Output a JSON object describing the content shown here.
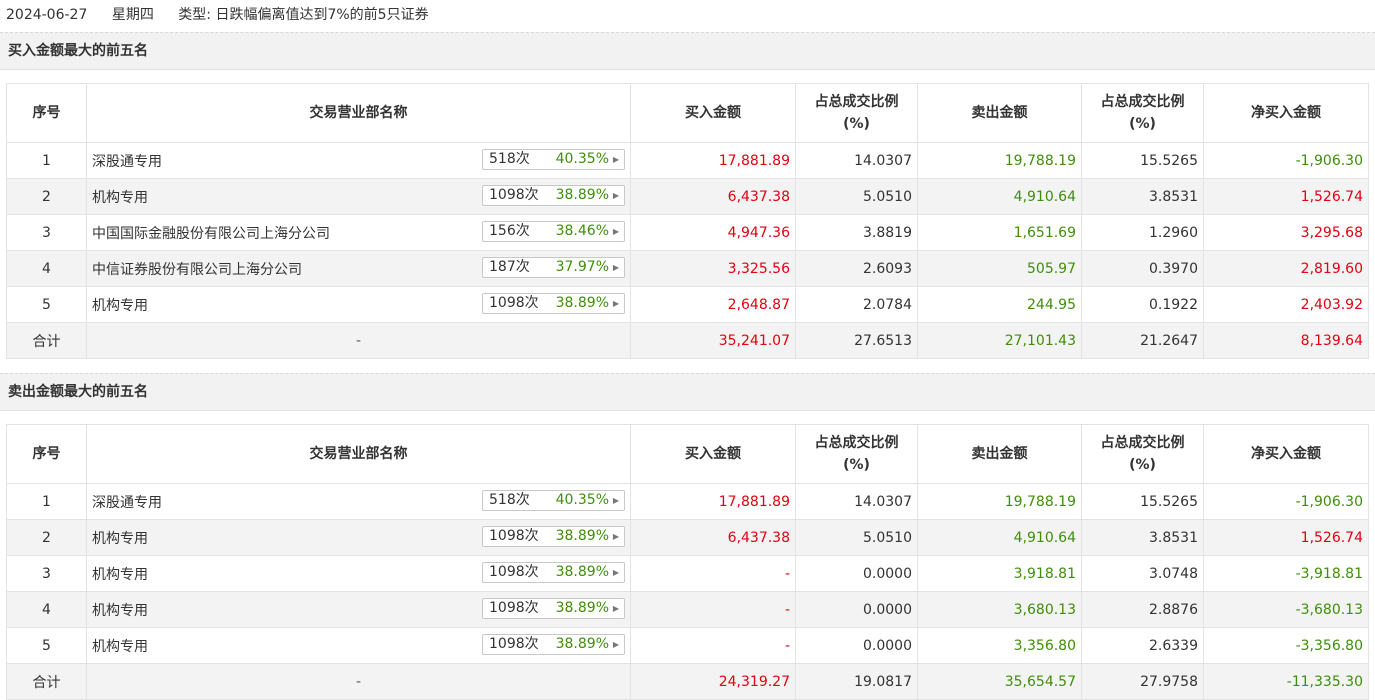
{
  "header": {
    "date": "2024-06-27",
    "weekday": "星期四",
    "type_label": "类型:",
    "type_value": "日跌幅偏离值达到7%的前5只证券"
  },
  "columns": {
    "idx": "序号",
    "name": "交易营业部名称",
    "buy": "买入金额",
    "buy_ratio_line1": "占总成交比例",
    "buy_ratio_line2": "(%)",
    "sell": "卖出金额",
    "sell_ratio_line1": "占总成交比例",
    "sell_ratio_line2": "(%)",
    "net": "净买入金额"
  },
  "buy_top5": {
    "title": "买入金额最大的前五名",
    "rows": [
      {
        "idx": "1",
        "name": "深股通专用",
        "count": "518次",
        "win": "40.35%",
        "buy": "17,881.89",
        "buy_ratio": "14.0307",
        "sell": "19,788.19",
        "sell_ratio": "15.5265",
        "net": "-1,906.30",
        "net_color": "green"
      },
      {
        "idx": "2",
        "name": "机构专用",
        "count": "1098次",
        "win": "38.89%",
        "buy": "6,437.38",
        "buy_ratio": "5.0510",
        "sell": "4,910.64",
        "sell_ratio": "3.8531",
        "net": "1,526.74",
        "net_color": "red"
      },
      {
        "idx": "3",
        "name": "中国国际金融股份有限公司上海分公司",
        "count": "156次",
        "win": "38.46%",
        "buy": "4,947.36",
        "buy_ratio": "3.8819",
        "sell": "1,651.69",
        "sell_ratio": "1.2960",
        "net": "3,295.68",
        "net_color": "red"
      },
      {
        "idx": "4",
        "name": "中信证券股份有限公司上海分公司",
        "count": "187次",
        "win": "37.97%",
        "buy": "3,325.56",
        "buy_ratio": "2.6093",
        "sell": "505.97",
        "sell_ratio": "0.3970",
        "net": "2,819.60",
        "net_color": "red"
      },
      {
        "idx": "5",
        "name": "机构专用",
        "count": "1098次",
        "win": "38.89%",
        "buy": "2,648.87",
        "buy_ratio": "2.0784",
        "sell": "244.95",
        "sell_ratio": "0.1922",
        "net": "2,403.92",
        "net_color": "red"
      }
    ],
    "total": {
      "label": "合计",
      "name": "-",
      "buy": "35,241.07",
      "buy_ratio": "27.6513",
      "sell": "27,101.43",
      "sell_ratio": "21.2647",
      "net": "8,139.64",
      "net_color": "red"
    }
  },
  "sell_top5": {
    "title": "卖出金额最大的前五名",
    "rows": [
      {
        "idx": "1",
        "name": "深股通专用",
        "count": "518次",
        "win": "40.35%",
        "buy": "17,881.89",
        "buy_ratio": "14.0307",
        "sell": "19,788.19",
        "sell_ratio": "15.5265",
        "net": "-1,906.30",
        "net_color": "green"
      },
      {
        "idx": "2",
        "name": "机构专用",
        "count": "1098次",
        "win": "38.89%",
        "buy": "6,437.38",
        "buy_ratio": "5.0510",
        "sell": "4,910.64",
        "sell_ratio": "3.8531",
        "net": "1,526.74",
        "net_color": "red"
      },
      {
        "idx": "3",
        "name": "机构专用",
        "count": "1098次",
        "win": "38.89%",
        "buy": "-",
        "buy_ratio": "0.0000",
        "sell": "3,918.81",
        "sell_ratio": "3.0748",
        "net": "-3,918.81",
        "net_color": "green"
      },
      {
        "idx": "4",
        "name": "机构专用",
        "count": "1098次",
        "win": "38.89%",
        "buy": "-",
        "buy_ratio": "0.0000",
        "sell": "3,680.13",
        "sell_ratio": "2.8876",
        "net": "-3,680.13",
        "net_color": "green"
      },
      {
        "idx": "5",
        "name": "机构专用",
        "count": "1098次",
        "win": "38.89%",
        "buy": "-",
        "buy_ratio": "0.0000",
        "sell": "3,356.80",
        "sell_ratio": "2.6339",
        "net": "-3,356.80",
        "net_color": "green"
      }
    ],
    "total": {
      "label": "合计",
      "name": "-",
      "buy": "24,319.27",
      "buy_ratio": "19.0817",
      "sell": "35,654.57",
      "sell_ratio": "27.9758",
      "net": "-11,335.30",
      "net_color": "green"
    }
  },
  "colors": {
    "red": "#e3000f",
    "green": "#3f8e0a",
    "row_alt": "#f3f3f3",
    "section_bg": "#f2f2f2"
  },
  "icons": {
    "stat_arrow": "triangle-right-icon"
  }
}
